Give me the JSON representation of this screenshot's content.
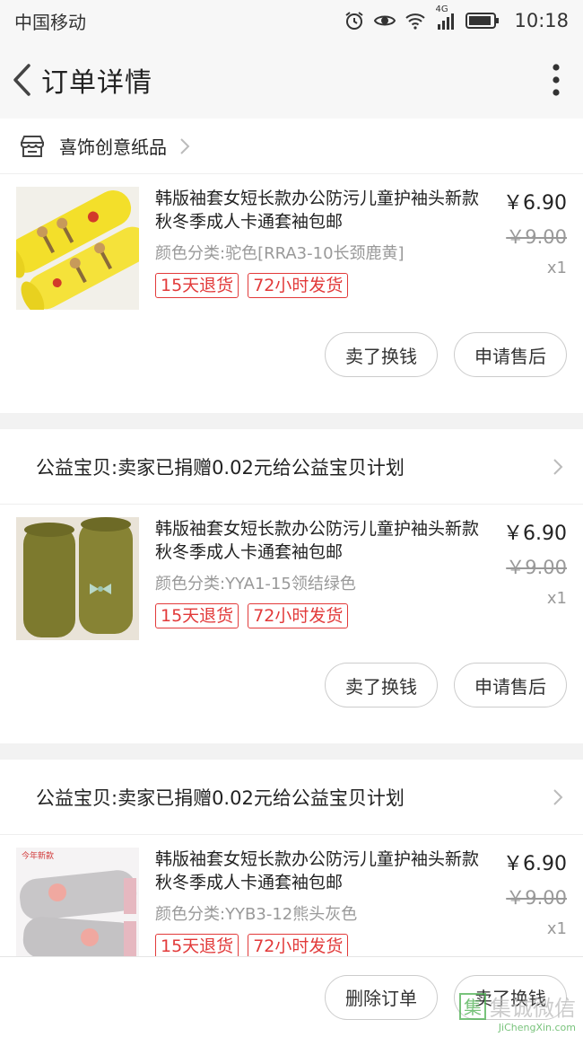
{
  "statusbar": {
    "carrier": "中国移动",
    "network": "4G",
    "time": "10:18"
  },
  "header": {
    "title": "订单详情"
  },
  "shop": {
    "name": "喜饰创意纸品"
  },
  "items": [
    {
      "title": "韩版袖套女短长款办公防污儿童护袖头新款秋冬季成人卡通套袖包邮",
      "sku": "颜色分类:驼色[RRA3-10长颈鹿黄]",
      "tags": [
        "15天退货",
        "72小时发货"
      ],
      "price": "￥6.90",
      "original_price": "￥9.00",
      "qty": "x1",
      "buttons": [
        "卖了换钱",
        "申请售后"
      ],
      "thumb_color": "yellow"
    },
    {
      "title": "韩版袖套女短长款办公防污儿童护袖头新款秋冬季成人卡通套袖包邮",
      "sku": "颜色分类:YYA1-15领结绿色",
      "tags": [
        "15天退货",
        "72小时发货"
      ],
      "price": "￥6.90",
      "original_price": "￥9.00",
      "qty": "x1",
      "buttons": [
        "卖了换钱",
        "申请售后"
      ],
      "thumb_color": "olive-green"
    },
    {
      "title": "韩版袖套女短长款办公防污儿童护袖头新款秋冬季成人卡通套袖包邮",
      "sku": "颜色分类:YYB3-12熊头灰色",
      "tags": [
        "15天退货",
        "72小时发货"
      ],
      "price": "￥6.90",
      "original_price": "￥9.00",
      "qty": "x1",
      "thumb_color": "grey",
      "thumb_caption": "今年新款"
    }
  ],
  "charity": {
    "text": "公益宝贝:卖家已捐赠0.02元给公益宝贝计划"
  },
  "bottom": {
    "buttons": [
      "删除订单",
      "卖了换钱"
    ]
  },
  "watermark": {
    "brand": "集诚微信",
    "url": "JiChengXin.com"
  },
  "colors": {
    "accent_red": "#e23a3a",
    "tag_border": "#e23a3a",
    "watermark_green": "#4caf50"
  }
}
